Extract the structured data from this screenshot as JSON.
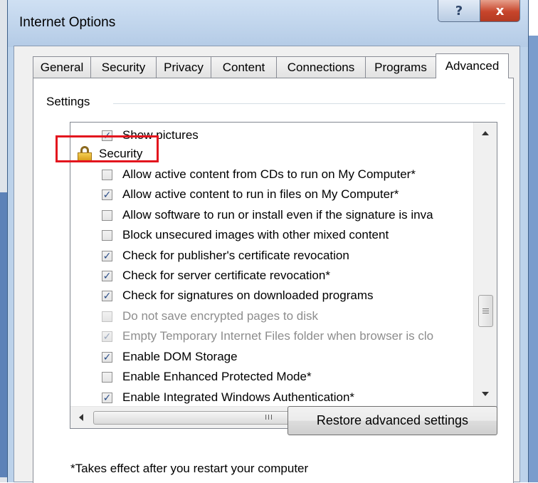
{
  "window": {
    "title": "Internet Options",
    "help_glyph": "?",
    "close_glyph": "x"
  },
  "tabs": [
    {
      "label": "General"
    },
    {
      "label": "Security"
    },
    {
      "label": "Privacy"
    },
    {
      "label": "Content"
    },
    {
      "label": "Connections"
    },
    {
      "label": "Programs"
    },
    {
      "label": "Advanced",
      "active": true
    }
  ],
  "settings": {
    "group_label": "Settings",
    "items": [
      {
        "label": "Show pictures",
        "checked": true
      },
      {
        "label": "Security",
        "icon": "lock-icon",
        "highlighted": true
      },
      {
        "label": "Allow active content from CDs to run on My Computer*",
        "checked": false
      },
      {
        "label": "Allow active content to run in files on My Computer*",
        "checked": true
      },
      {
        "label": "Allow software to run or install even if the signature is inva",
        "checked": false
      },
      {
        "label": "Block unsecured images with other mixed content",
        "checked": false
      },
      {
        "label": "Check for publisher's certificate revocation",
        "checked": true
      },
      {
        "label": "Check for server certificate revocation*",
        "checked": true
      },
      {
        "label": "Check for signatures on downloaded programs",
        "checked": true
      },
      {
        "label": "Do not save encrypted pages to disk",
        "checked": false,
        "disabled": true
      },
      {
        "label": "Empty Temporary Internet Files folder when browser is clo",
        "checked": true,
        "disabled": true
      },
      {
        "label": "Enable DOM Storage",
        "checked": true
      },
      {
        "label": "Enable Enhanced Protected Mode*",
        "checked": false
      },
      {
        "label": "Enable Integrated Windows Authentication*",
        "checked": true
      }
    ],
    "hscroll_grip": "III"
  },
  "footer": {
    "note": "*Takes effect after you restart your computer",
    "restore_button": "Restore advanced settings"
  },
  "colors": {
    "highlight_box": "#e3151e",
    "checkmark": "#2a4d87",
    "close_button": "#c7452b"
  }
}
